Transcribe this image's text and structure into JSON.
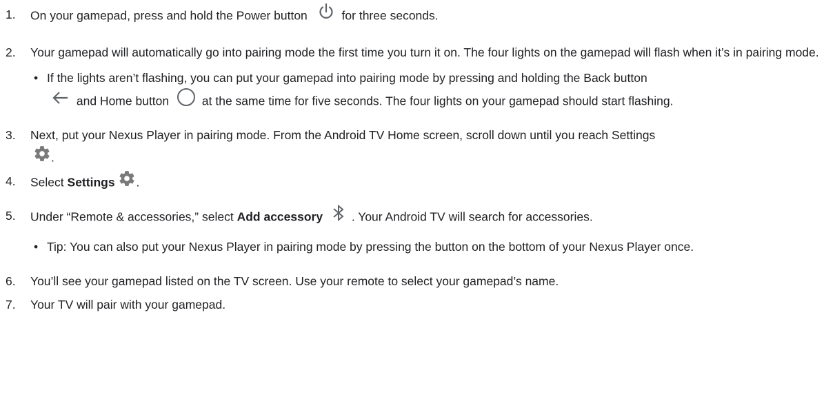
{
  "steps": [
    {
      "number": "1.",
      "text_a": "On your gamepad, press and hold the Power button",
      "text_b": "for three seconds."
    },
    {
      "number": "2.",
      "text_a": "Your gamepad will automatically go into pairing mode the first time you turn it on. The four lights on the gamepad will flash when it’s in pairing mode.",
      "bullet": {
        "text_a": "If the lights aren’t flashing, you can put your gamepad into pairing mode by pressing and holding the Back button",
        "text_b": "and Home button",
        "text_c": "at the same time for five seconds. The four lights on your gamepad should start flashing."
      }
    },
    {
      "number": "3.",
      "text_a": "Next, put your Nexus Player in pairing mode. From the Android TV Home screen, scroll down until you reach Settings",
      "text_b": "."
    },
    {
      "number": "4.",
      "text_a": "Select",
      "bold": "Settings",
      "text_b": "."
    },
    {
      "number": "5.",
      "text_a": "Under “Remote & accessories,” select",
      "bold": "Add accessory",
      "text_b": ". Your Android TV will search for accessories.",
      "bullet": {
        "text_a": "Tip: You can also put your Nexus Player in pairing mode by pressing the button on the bottom of your Nexus Player once."
      }
    },
    {
      "number": "6.",
      "text_a": "You’ll see your gamepad listed on the TV screen. Use your remote to select your gamepad’s name."
    },
    {
      "number": "7.",
      "text_a": "Your TV will pair with your gamepad."
    }
  ],
  "icons": {
    "power": "power-icon",
    "back": "back-arrow-icon",
    "home": "home-circle-icon",
    "settings": "settings-gear-icon",
    "bluetooth": "bluetooth-icon"
  },
  "colors": {
    "text": "#202124",
    "icon": "#5f6368",
    "settings_icon": "#7a7a7a"
  }
}
